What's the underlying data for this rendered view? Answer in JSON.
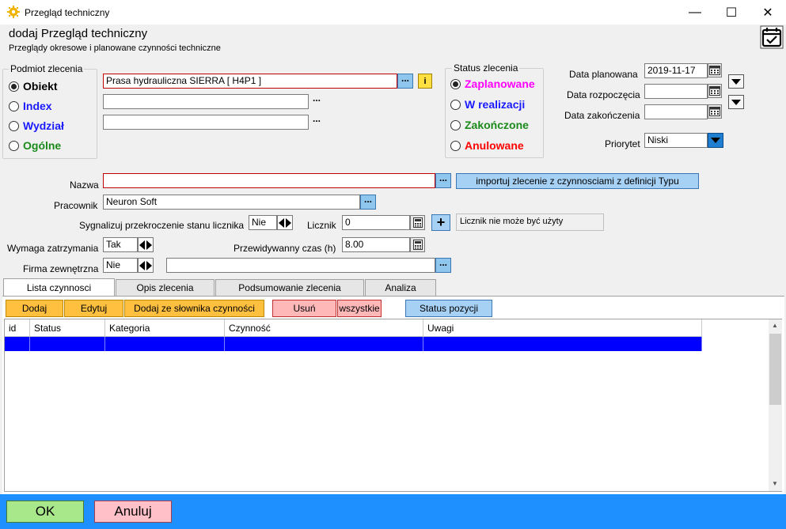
{
  "window": {
    "title": "Przegląd techniczny",
    "minimize": "—",
    "maximize": "☐",
    "close": "✕"
  },
  "header": {
    "title": "dodaj Przegląd techniczny",
    "subtitle": "Przeglądy okresowe i planowane czynności techniczne"
  },
  "podmiot": {
    "legend": "Podmiot zlecenia",
    "options": [
      {
        "label": "Obiekt",
        "color": "#000000",
        "checked": true
      },
      {
        "label": "Index",
        "color": "#1a1aff",
        "checked": false
      },
      {
        "label": "Wydział",
        "color": "#1a1aff",
        "checked": false
      },
      {
        "label": "Ogólne",
        "color": "#1a8a1a",
        "checked": false
      }
    ],
    "field1_value": "Prasa hydrauliczna SIERRA [ H4P1 ]",
    "field2_value": "",
    "field3_value": "",
    "dots": "...",
    "info_button": "i"
  },
  "status": {
    "legend": "Status zlecenia",
    "options": [
      {
        "label": "Zaplanowane",
        "color": "#ff00ff",
        "checked": true
      },
      {
        "label": "W realizacji",
        "color": "#1a1aff",
        "checked": false
      },
      {
        "label": "Zakończone",
        "color": "#1a8a1a",
        "checked": false
      },
      {
        "label": "Anulowane",
        "color": "#ff0000",
        "checked": false
      }
    ]
  },
  "dates": {
    "planowana_label": "Data planowana",
    "planowana_value": "2019-11-17",
    "rozpoczecia_label": "Data rozpoczęcia",
    "rozpoczecia_value": "",
    "zakonczenia_label": "Data zakończenia",
    "zakonczenia_value": ""
  },
  "priorytet": {
    "label": "Priorytet",
    "value": "Niski"
  },
  "form": {
    "nazwa_label": "Nazwa",
    "nazwa_value": "",
    "import_button": "importuj zlecenie z czynnosciami z definicji Typu",
    "pracownik_label": "Pracownik",
    "pracownik_value": "Neuron Soft",
    "sygnalizuj_label": "Sygnalizuj przekroczenie stanu licznika",
    "sygnalizuj_value": "Nie",
    "licznik_label": "Licznik",
    "licznik_value": "0",
    "plus": "+",
    "licznik_note": "Licznik nie może być użyty",
    "wymaga_label": "Wymaga zatrzymania",
    "wymaga_value": "Tak",
    "czas_label": "Przewidywanny czas  (h)",
    "czas_value": "8.00",
    "firma_label": "Firma zewnętrzna",
    "firma_value": "Nie",
    "firma_name_value": ""
  },
  "tabs": [
    {
      "label": "Lista czynnosci",
      "active": true
    },
    {
      "label": "Opis zlecenia",
      "active": false
    },
    {
      "label": "Podsumowanie zlecenia",
      "active": false
    },
    {
      "label": "Analiza",
      "active": false
    }
  ],
  "toolbar": {
    "dodaj": "Dodaj",
    "edytuj": "Edytuj",
    "dodaj_slownik": "Dodaj ze słownika czynności",
    "usun": "Usuń",
    "wszystkie": "wszystkie",
    "status_pozycji": "Status pozycji"
  },
  "grid": {
    "columns": [
      "id",
      "Status",
      "Kategoria",
      "Czynność",
      "Uwagi"
    ],
    "scroll_up": "▲",
    "scroll_down": "▼"
  },
  "footer": {
    "ok": "OK",
    "anuluj": "Anuluj"
  },
  "colors": {
    "accent": "#1e90ff",
    "selection": "#0000ff",
    "ok": "#a8e88a",
    "cancel": "#ffc0c8"
  }
}
